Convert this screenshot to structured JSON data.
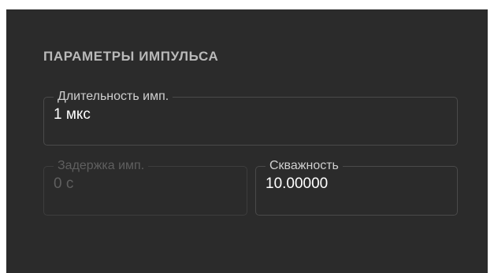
{
  "section": {
    "title": "ПАРАМЕТРЫ ИМПУЛЬСА"
  },
  "fields": {
    "pulse_duration": {
      "label": "Длительность имп.",
      "value": "1 мкс",
      "enabled": true
    },
    "pulse_delay": {
      "label": "Задержка имп.",
      "value": "0 с",
      "enabled": false
    },
    "duty_cycle": {
      "label": "Скважность",
      "value": "10.00000",
      "enabled": true
    }
  },
  "colors": {
    "panel_background": "#2b2b2b",
    "border": "#4a4a4a",
    "text": "#ffffff",
    "label": "#cfcfcf",
    "disabled_text": "#5f5f5f"
  }
}
